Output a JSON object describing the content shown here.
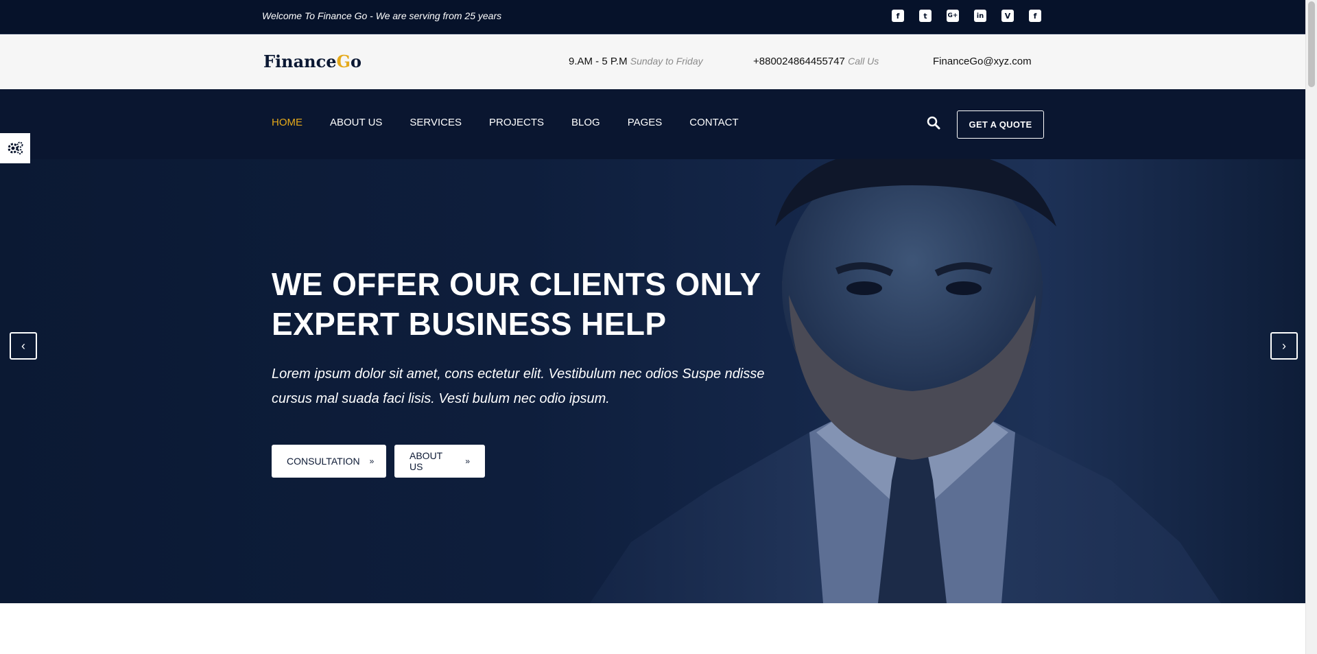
{
  "topbar": {
    "welcome": "Welcome To Finance Go - We are serving from 25 years",
    "socials": [
      {
        "icon": "facebook-icon",
        "glyph": "f"
      },
      {
        "icon": "twitter-icon",
        "glyph": "t"
      },
      {
        "icon": "google-plus-icon",
        "glyph": "G+"
      },
      {
        "icon": "linkedin-icon",
        "glyph": "in"
      },
      {
        "icon": "vimeo-icon",
        "glyph": "V"
      },
      {
        "icon": "facebook-icon",
        "glyph": "f"
      }
    ]
  },
  "brand": {
    "part1": "Finance",
    "part2": "G",
    "part3": "o",
    "accent_color": "#e5a91a"
  },
  "info": {
    "hours": "9.AM - 5 P.M",
    "hours_sub": "Sunday to Friday",
    "phone": "+880024864455747",
    "phone_sub": "Call Us",
    "email": "FinanceGo@xyz.com"
  },
  "nav": {
    "items": [
      "HOME",
      "ABOUT US",
      "SERVICES",
      "PROJECTS",
      "BLOG",
      "PAGES",
      "CONTACT"
    ],
    "active": "HOME",
    "quote_label": "GET A QUOTE"
  },
  "hero": {
    "headline_line1": "WE OFFER OUR CLIENTS ONLY",
    "headline_line2": "EXPERT BUSINESS HELP",
    "lead": "Lorem ipsum dolor sit amet, cons ectetur elit. Vestibulum nec odios Suspe ndisse cursus mal suada faci lisis. Vesti bulum nec odio ipsum.",
    "cta1": "CONSULTATION",
    "cta2": "ABOUT US",
    "prev_icon": "chevron-left-icon",
    "next_icon": "chevron-right-icon"
  },
  "colors": {
    "topbar": "#06122a",
    "hero": "#091733",
    "accent": "#e5a91a"
  }
}
